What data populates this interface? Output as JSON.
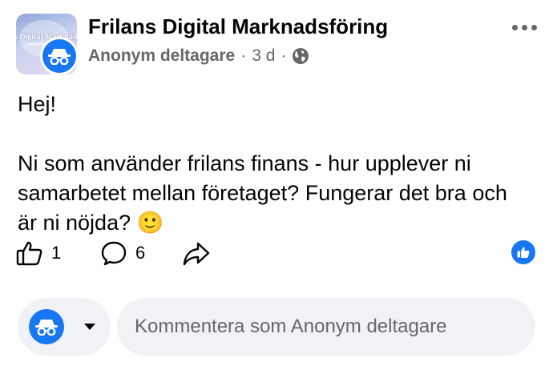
{
  "post": {
    "group_name": "Frilans Digital Marknadsföring",
    "group_avatar_text": "s Digital Marknads",
    "author": "Anonym deltagare",
    "separator": "·",
    "time": "3 d",
    "audience_icon": "globe-icon",
    "lines": [
      "Hej!",
      "",
      "Ni som använder frilans finans - hur upplever ni",
      "samarbetet mellan företaget? Fungerar det bra och",
      "är ni nöjda? 🙂"
    ]
  },
  "actions": {
    "like_count": "1",
    "comment_count": "6",
    "reaction_icon": "thumbs-up-icon"
  },
  "composer": {
    "placeholder": "Kommentera som Anonym deltagare"
  },
  "colors": {
    "accent": "#1877f2",
    "secondary_text": "#65676b",
    "input_bg": "#f0f2f5"
  }
}
